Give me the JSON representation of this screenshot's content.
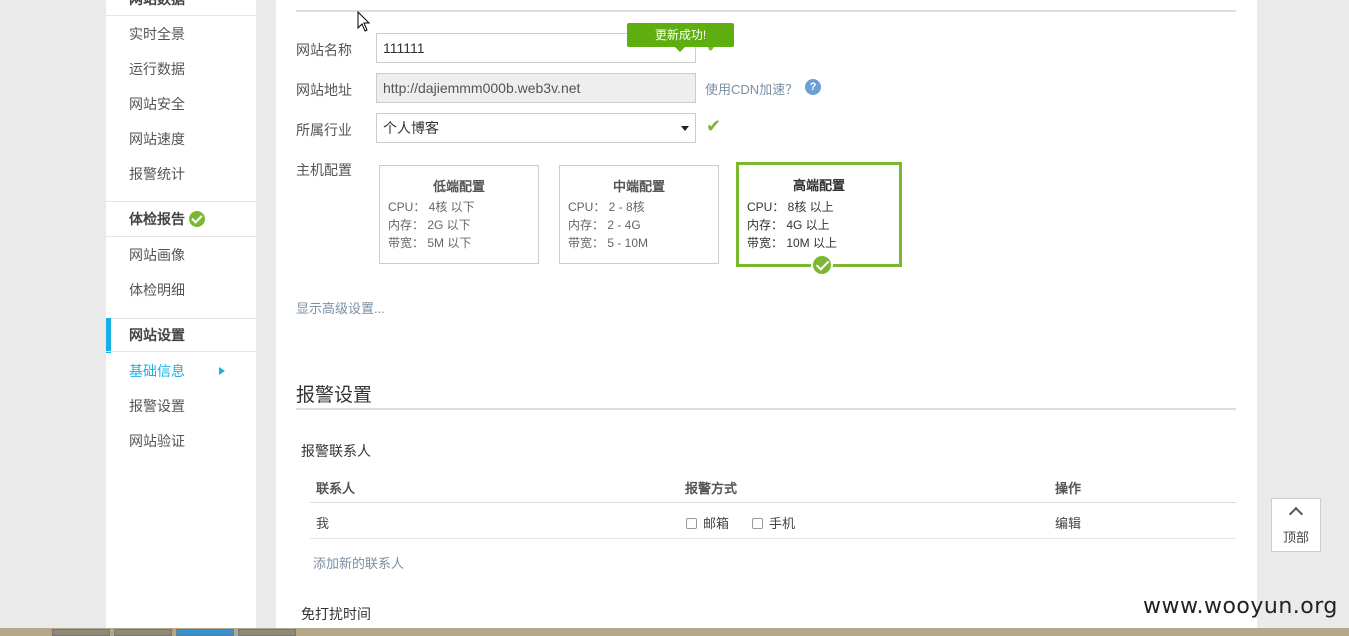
{
  "sidebar": {
    "top_partial_label": "网站数据",
    "data_items": [
      "实时全景",
      "运行数据",
      "网站安全",
      "网站速度",
      "报警统计"
    ],
    "report_group": "体检报告",
    "report_items": [
      "网站画像",
      "体检明细"
    ],
    "settings_group": "网站设置",
    "settings_items": [
      "基础信息",
      "报警设置",
      "网站验证"
    ]
  },
  "basic_info": {
    "toast": "更新成功!",
    "site_name_label": "网站名称",
    "site_name_value": "111111",
    "site_url_label": "网站地址",
    "site_url_value": "http://dajiemmm000b.web3v.net",
    "cdn_link": "使用CDN加速？",
    "help_icon": "?",
    "industry_label": "所属行业",
    "industry_value": "个人博客",
    "host_label": "主机配置",
    "host_cards": [
      {
        "title": "低端配置",
        "cpu": "CPU： 4核 以下",
        "mem": "内存： 2G 以下",
        "bw": "带宽： 5M 以下",
        "selected": false
      },
      {
        "title": "中端配置",
        "cpu": "CPU： 2 - 8核",
        "mem": "内存： 2 - 4G",
        "bw": "带宽： 5 - 10M",
        "selected": false
      },
      {
        "title": "高端配置",
        "cpu": "CPU： 8核 以上",
        "mem": "内存： 4G 以上",
        "bw": "带宽： 10M 以上",
        "selected": true
      }
    ],
    "advanced_link": "显示高级设置..."
  },
  "alarm": {
    "title": "报警设置",
    "contacts_label": "报警联系人",
    "columns": [
      "联系人",
      "报警方式",
      "操作"
    ],
    "rows": [
      {
        "contact": "我",
        "methods": [
          "邮箱",
          "手机"
        ],
        "action": "编辑"
      }
    ],
    "add_contact": "添加新的联系人",
    "dnd_label": "免打扰时间"
  },
  "back_to_top": "顶部",
  "watermark": "www.wooyun.org",
  "colors": {
    "accent": "#1ab0e6",
    "success": "#7cb82f",
    "toast": "#5fae10"
  }
}
